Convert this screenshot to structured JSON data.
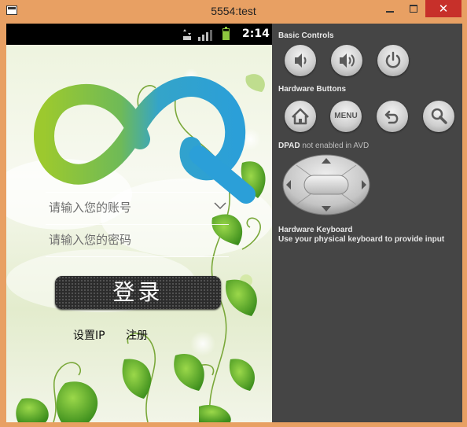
{
  "window": {
    "title": "5554:test",
    "close_glyph": "✕"
  },
  "statusbar": {
    "time": "2:14"
  },
  "login": {
    "username_placeholder": "请输入您的账号",
    "password_placeholder": "请输入您的密码",
    "login_label": "登录",
    "settings_ip_label": "设置IP",
    "register_label": "注册"
  },
  "controls": {
    "basic_controls_title": "Basic Controls",
    "hardware_buttons_title": "Hardware Buttons",
    "menu_label": "MENU",
    "dpad_title": "DPAD",
    "dpad_note": "not enabled in AVD",
    "keyboard_title": "Hardware Keyboard",
    "keyboard_note": "Use your physical keyboard to provide input"
  },
  "icons": {
    "volume_down": "volume-down-icon",
    "volume_up": "volume-up-icon",
    "power": "power-icon",
    "home": "home-icon",
    "back": "back-icon",
    "search": "search-icon"
  },
  "colors": {
    "titlebar": "#e8a063",
    "close": "#c7302a",
    "panel": "#454545",
    "logo_green": "#8cc63f",
    "logo_blue": "#2b9fd8"
  }
}
